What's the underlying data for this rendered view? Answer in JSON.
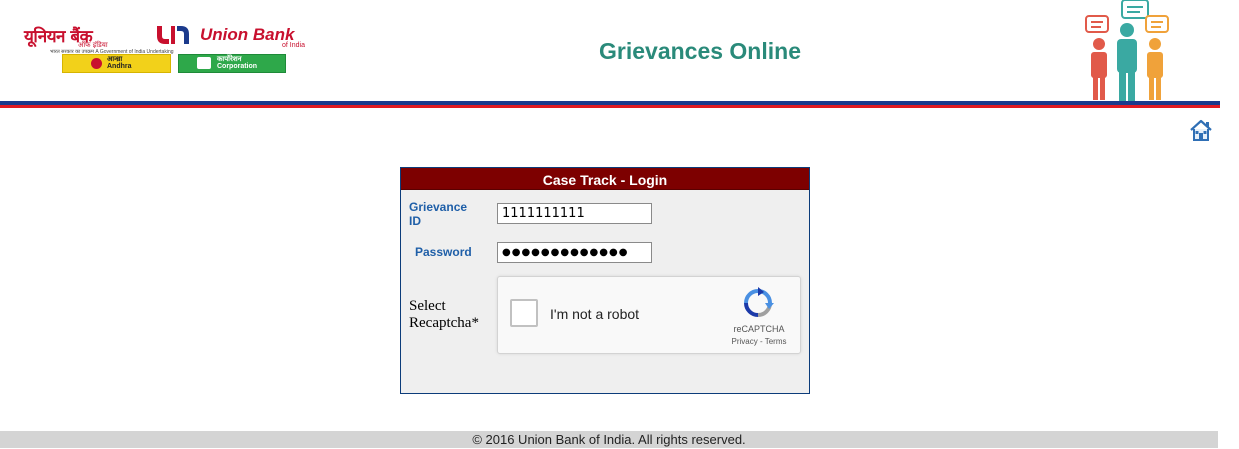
{
  "header": {
    "logo": {
      "hindi_name": "यूनियन बैंक",
      "hindi_sub": "ऑफ इंडिया",
      "english_name": "Union Bank",
      "english_sub": "of India",
      "tagline": "भारत सरकार का उपक्रम   A Government of India Undertaking",
      "andhra_hindi": "आन्ध्रा",
      "andhra_label": "Andhra",
      "corporation_hindi": "कार्पोरेशन",
      "corporation_label": "Corporation"
    },
    "title": "Grievances Online"
  },
  "login": {
    "panel_title": "Case Track - Login",
    "grievance_id_label": "Grievance ID",
    "grievance_id_value": "1111111111",
    "password_label": "Password",
    "password_masked": "●●●●●●●●●●●●●",
    "captcha_label": "Select Recaptcha*",
    "recaptcha": {
      "checkbox_label": "I'm not a robot",
      "brand": "reCAPTCHA",
      "links": "Privacy - Terms"
    }
  },
  "footer": {
    "copyright": "© 2016 Union Bank of India. All rights reserved."
  },
  "icons": {
    "home": "home-icon",
    "recaptcha": "recaptcha-logo-icon"
  },
  "colors": {
    "title": "#2a8a7a",
    "panel_header": "#7d0000",
    "label": "#1f5fa8",
    "rule_blue": "#1b3a8c",
    "rule_red": "#e11b22",
    "footer_bg": "#d4d4d4"
  }
}
